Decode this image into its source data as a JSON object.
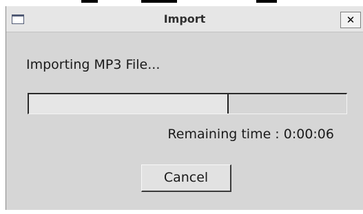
{
  "window": {
    "title": "Import",
    "close_label": "✕",
    "icon": "window-icon"
  },
  "status": {
    "message": "Importing MP3 File...",
    "remaining": "Remaining time : 0:00:06"
  },
  "progress": {
    "fraction": 0.63
  },
  "actions": {
    "cancel_label": "Cancel"
  }
}
